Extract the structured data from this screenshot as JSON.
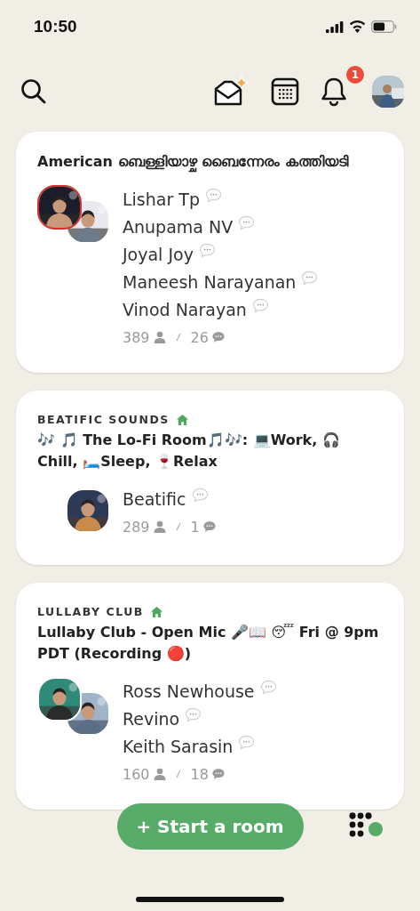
{
  "status_bar": {
    "time": "10:50"
  },
  "header": {
    "notification_count": "1"
  },
  "rooms": [
    {
      "title": "American ബെള്ളിയാഴ്ച ബൈന്നേരം കത്തിയടി",
      "avatars": [
        {
          "speaking": true
        },
        {
          "speaking": false
        }
      ],
      "speakers": [
        "Lishar Tp",
        "Anupama NV",
        "Joyal Joy",
        "Maneesh Narayanan",
        "Vinod Narayan"
      ],
      "listeners": "389",
      "speaker_count": "26"
    },
    {
      "club": "BEATIFIC SOUNDS",
      "title": "🎶 🎵 The Lo-Fi Room🎵🎶: 💻Work, 🎧 Chill, 🛏️Sleep, 🍷Relax",
      "avatars": [
        {
          "speaking": false
        }
      ],
      "speakers": [
        "Beatific"
      ],
      "listeners": "289",
      "speaker_count": "1"
    },
    {
      "club": "LULLABY CLUB",
      "title": "Lullaby Club - Open Mic 🎤📖 😴 Fri @ 9pm PDT (Recording 🔴)",
      "avatars": [
        {
          "speaking": false
        },
        {
          "speaking": false
        }
      ],
      "speakers": [
        "Ross Newhouse",
        "Revino",
        "Keith Sarasin"
      ],
      "listeners": "160",
      "speaker_count": "18"
    }
  ],
  "start_button": {
    "label": "+ Start a room"
  }
}
